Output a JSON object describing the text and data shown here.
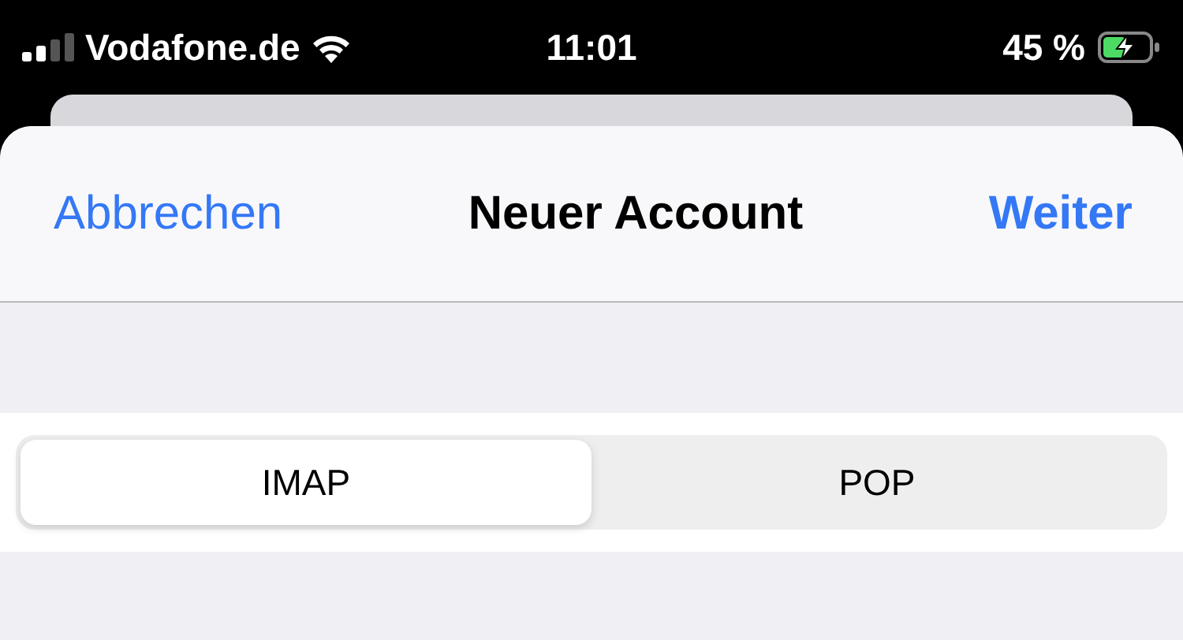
{
  "status_bar": {
    "carrier": "Vodafone.de",
    "time": "11:01",
    "battery": "45 %"
  },
  "nav": {
    "cancel": "Abbrechen",
    "title": "Neuer Account",
    "next": "Weiter"
  },
  "segments": [
    {
      "label": "IMAP",
      "selected": true
    },
    {
      "label": "POP",
      "selected": false
    }
  ]
}
